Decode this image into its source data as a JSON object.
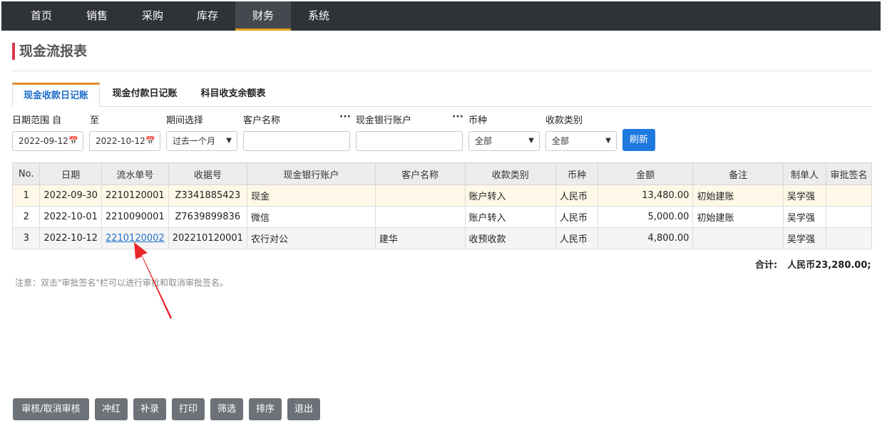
{
  "nav": {
    "items": [
      {
        "label": "首页"
      },
      {
        "label": "销售"
      },
      {
        "label": "采购"
      },
      {
        "label": "库存"
      },
      {
        "label": "财务"
      },
      {
        "label": "系统"
      }
    ],
    "active_index": 4
  },
  "page": {
    "title": "现金流报表"
  },
  "tabs": [
    {
      "label": "现金收款日记账",
      "active": true
    },
    {
      "label": "现金付款日记账",
      "active": false
    },
    {
      "label": "科目收支余额表",
      "active": false
    }
  ],
  "filters": {
    "date_from_label": "日期范围 自",
    "date_to_label": "至",
    "period_label": "期间选择",
    "customer_label": "客户名称",
    "account_label": "现金银行账户",
    "currency_label": "币种",
    "category_label": "收款类别",
    "more_glyph": "···",
    "date_from_value": "2022-09-12",
    "date_to_value": "2022-10-12",
    "period_value": "过去一个月",
    "customer_value": "",
    "account_value": "",
    "currency_value": "全部",
    "category_value": "全部",
    "refresh_label": "刷新"
  },
  "table": {
    "columns": [
      "No.",
      "日期",
      "流水单号",
      "收据号",
      "现金银行账户",
      "客户名称",
      "收款类别",
      "币种",
      "金额",
      "备注",
      "制单人",
      "审批签名"
    ],
    "rows": [
      {
        "no": "1",
        "date": "2022-09-30",
        "serial": "2210120001",
        "receipt": "Z3341885423",
        "account": "现金",
        "customer": "",
        "category": "账户转入",
        "currency": "人民币",
        "amount": "13,480.00",
        "remark": "初始建账",
        "maker": "吴学强",
        "approval": ""
      },
      {
        "no": "2",
        "date": "2022-10-01",
        "serial": "2210090001",
        "receipt": "Z7639899836",
        "account": "微信",
        "customer": "",
        "category": "账户转入",
        "currency": "人民币",
        "amount": "5,000.00",
        "remark": "初始建账",
        "maker": "吴学强",
        "approval": ""
      },
      {
        "no": "3",
        "date": "2022-10-12",
        "serial": "2210120002",
        "receipt": "202210120001",
        "account": "农行对公",
        "customer": "建华",
        "category": "收预收款",
        "currency": "人民币",
        "amount": "4,800.00",
        "remark": "",
        "maker": "吴学强",
        "approval": ""
      }
    ]
  },
  "summary": {
    "total_label": "合计:",
    "total_value": "人民币23,280.00;"
  },
  "note": "注意：双击\"审批签名\"栏可以进行审批和取消审批签名。",
  "annotation": {
    "arrow_color": "#e8282c"
  },
  "actions": [
    {
      "label": "审核/取消审核"
    },
    {
      "label": "冲红"
    },
    {
      "label": "补录"
    },
    {
      "label": "打印"
    },
    {
      "label": "筛选"
    },
    {
      "label": "排序"
    },
    {
      "label": "退出"
    }
  ]
}
